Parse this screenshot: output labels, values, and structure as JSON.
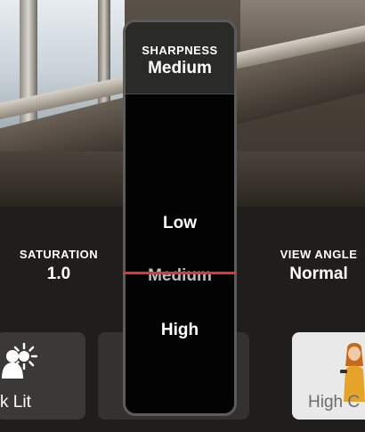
{
  "picker": {
    "title": "SHARPNESS",
    "current_value": "Medium",
    "options": [
      "Low",
      "Medium",
      "High"
    ],
    "selected_index": 1,
    "indicator_color": "#d83a33"
  },
  "settings": {
    "saturation": {
      "label": "SATURATION",
      "value": "1.0"
    },
    "view_angle": {
      "label": "VIEW ANGLE",
      "value": "Normal"
    }
  },
  "tiles": {
    "left": {
      "label": "k Lit",
      "icons": [
        "person-icon",
        "sun-icon"
      ]
    },
    "right": {
      "label": "High C",
      "icon": "figure-thumbnail"
    }
  }
}
